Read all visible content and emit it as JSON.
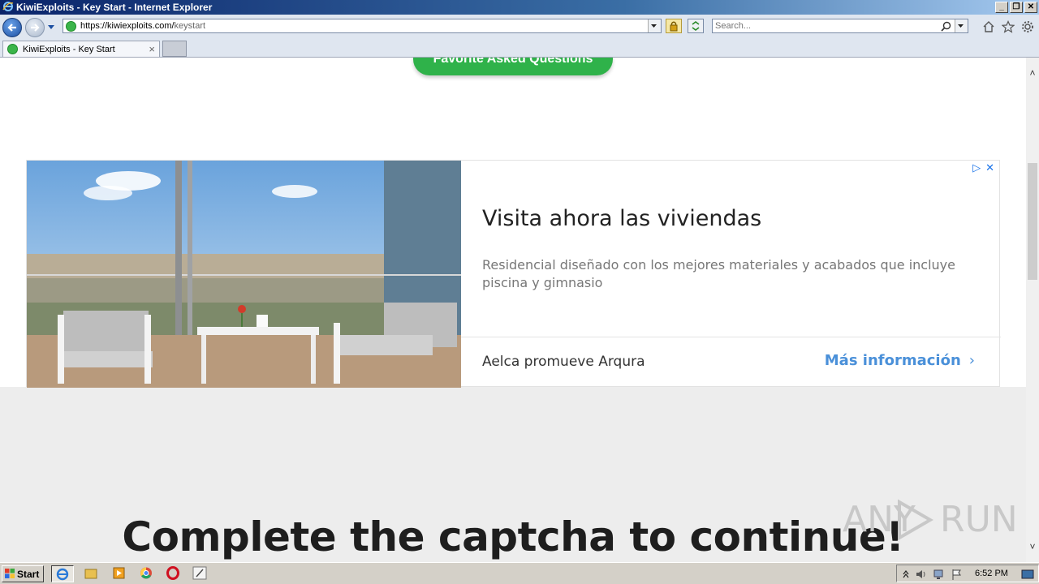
{
  "window": {
    "title": "KiwiExploits - Key Start - Internet Explorer",
    "controls": [
      "_",
      "❐",
      "✕"
    ]
  },
  "navbar": {
    "url_prefix": "https://kiwiexploits.com/",
    "url_path": "keystart",
    "search_placeholder": "Search..."
  },
  "tabs": [
    {
      "label": "KiwiExploits - Key Start",
      "close": "×"
    }
  ],
  "page": {
    "faq_button": "Favorite Asked Questions",
    "ad": {
      "title": "Visita ahora las viviendas",
      "description": "Residencial diseñado con los mejores materiales y acabados que incluye piscina y gimnasio",
      "advertiser": "Aelca promueve Arqura",
      "cta": "Más información",
      "cta_chevron": "›",
      "choices_icon": "▷",
      "close_icon": "✕"
    },
    "captcha_heading": "Complete the captcha to continue!",
    "watermark": {
      "left": "ANY",
      "right": "RUN"
    }
  },
  "scrollbar": {
    "up": "˄",
    "down": "˅"
  },
  "taskbar": {
    "start_label": "Start",
    "clock": "6:52 PM"
  },
  "colors": {
    "faq_green": "#2fb24a",
    "cta_blue": "#4a90d9",
    "page_bg": "#ededed"
  }
}
